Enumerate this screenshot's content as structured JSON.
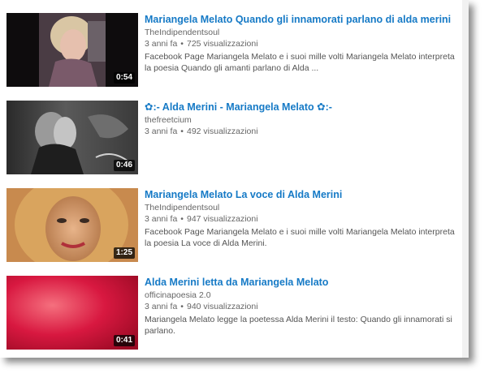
{
  "results": [
    {
      "title": "Mariangela Melato Quando gli innamorati parlano di alda merini",
      "channel": "TheIndipendentsoul",
      "age": "3 anni fa",
      "separator": "•",
      "views": "725 visualizzazioni",
      "description": "Facebook Page Mariangela Melato e i suoi mille volti Mariangela Melato interpreta la poesia Quando gli amanti parlano di Alda ...",
      "duration": "0:54"
    },
    {
      "title": "✿:- Alda Merini - Mariangela Melato ✿:-",
      "channel": "thefreetcium",
      "age": "3 anni fa",
      "separator": "•",
      "views": "492 visualizzazioni",
      "description": "",
      "duration": "0:46"
    },
    {
      "title": "Mariangela Melato La voce di Alda Merini",
      "channel": "TheIndipendentsoul",
      "age": "3 anni fa",
      "separator": "•",
      "views": "947 visualizzazioni",
      "description": "Facebook Page Mariangela Melato e i suoi mille volti Mariangela Melato interpreta la poesia La voce di Alda Merini.",
      "duration": "1:25"
    },
    {
      "title": "Alda Merini letta da Mariangela Melato",
      "channel": "officinapoesia 2.0",
      "age": "3 anni fa",
      "separator": "•",
      "views": "940 visualizzazioni",
      "description": "Mariangela Melato legge la poetessa Alda Merini il testo: Quando gli innamorati si parlano.",
      "duration": "0:41"
    }
  ],
  "colors": {
    "title_link": "#167ac6",
    "meta_text": "#666666",
    "duration_bg": "#000000"
  }
}
